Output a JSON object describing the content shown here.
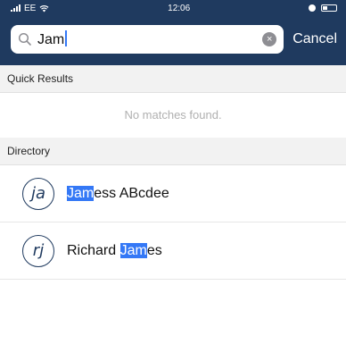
{
  "status_bar": {
    "carrier": "EE",
    "time": "12:06"
  },
  "search": {
    "query": "Jam",
    "cancel_label": "Cancel"
  },
  "quick_results": {
    "header": "Quick Results",
    "empty_text": "No matches found."
  },
  "directory": {
    "header": "Directory",
    "items": [
      {
        "initials": "ja",
        "name_highlight": "Jam",
        "name_rest": "ess ABcdee"
      },
      {
        "initials": "rj",
        "name_before": "Richard ",
        "name_highlight": "Jam",
        "name_after": "es"
      }
    ]
  },
  "colors": {
    "header_bg": "#1f3a5f",
    "highlight": "#3478f6"
  },
  "icons": [
    "wifi-icon",
    "search-icon",
    "clear-icon",
    "battery-icon",
    "signal-icon"
  ]
}
